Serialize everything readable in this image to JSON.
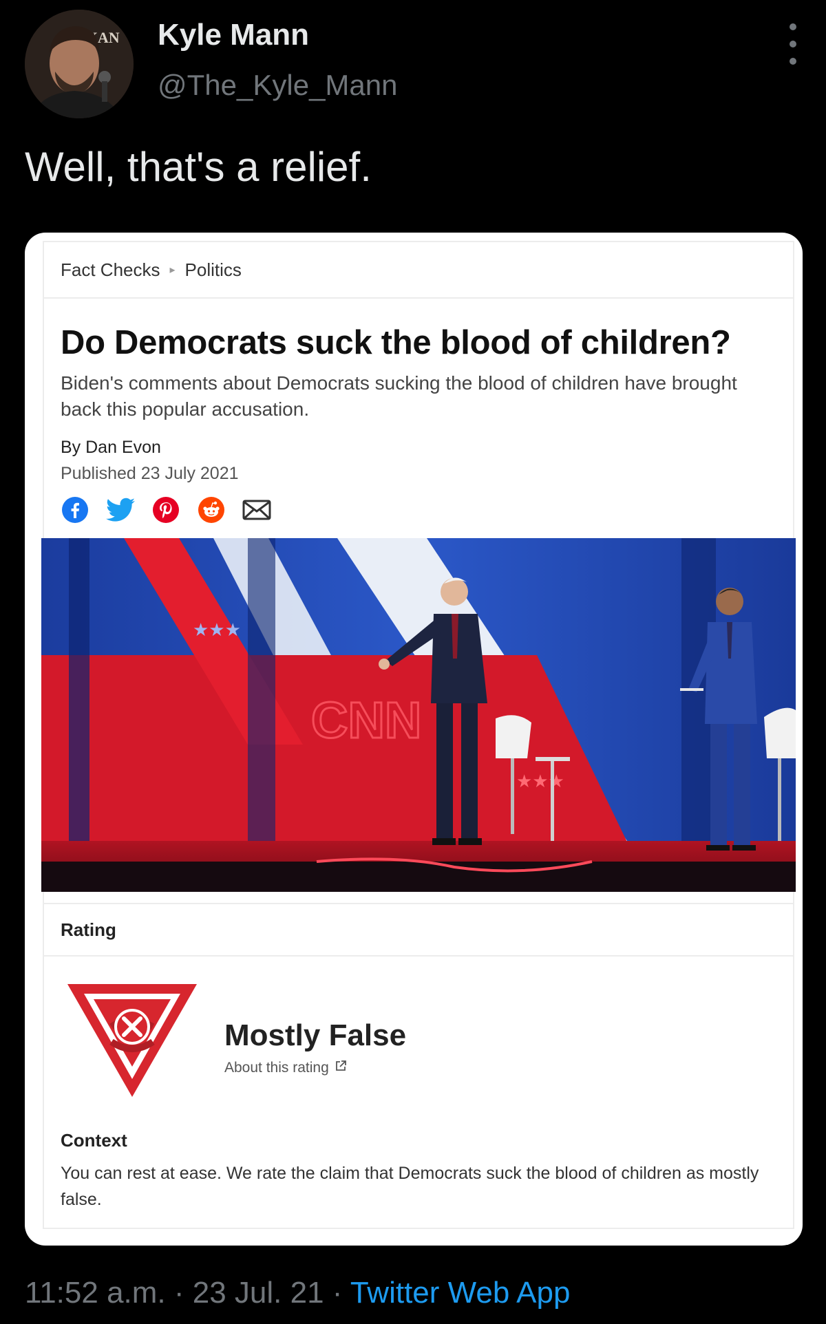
{
  "tweet": {
    "author": {
      "display_name": "Kyle Mann",
      "handle": "@The_Kyle_Mann",
      "avatar_icon": "profile-photo"
    },
    "text": "Well, that's a relief.",
    "timestamp": "11:52 a.m. · 23 Jul. 21 · ",
    "source_app": "Twitter Web App"
  },
  "card": {
    "breadcrumb": [
      "Fact Checks",
      "Politics"
    ],
    "headline": "Do Democrats suck the blood of children?",
    "subhead": "Biden's comments about Democrats sucking the blood of children have brought back this popular accusation.",
    "byline": "By Dan Evon",
    "published": "Published 23 July 2021",
    "share_icons": [
      "facebook-icon",
      "twitter-icon",
      "pinterest-icon",
      "reddit-icon",
      "email-icon"
    ],
    "image_caption_text": "CNN",
    "rating_section_label": "Rating",
    "rating_value": "Mostly False",
    "about_rating": "About this rating",
    "context_title": "Context",
    "context_body": "You can rest at ease. We rate the claim that Democrats suck the blood of children as mostly false."
  },
  "colors": {
    "background": "#000000",
    "link_blue": "#1d9bf0",
    "muted": "#71767b",
    "rating_red": "#d7262e",
    "facebook": "#1877f2",
    "twitter": "#1da1f2",
    "pinterest": "#e60023",
    "reddit": "#ff4500"
  }
}
